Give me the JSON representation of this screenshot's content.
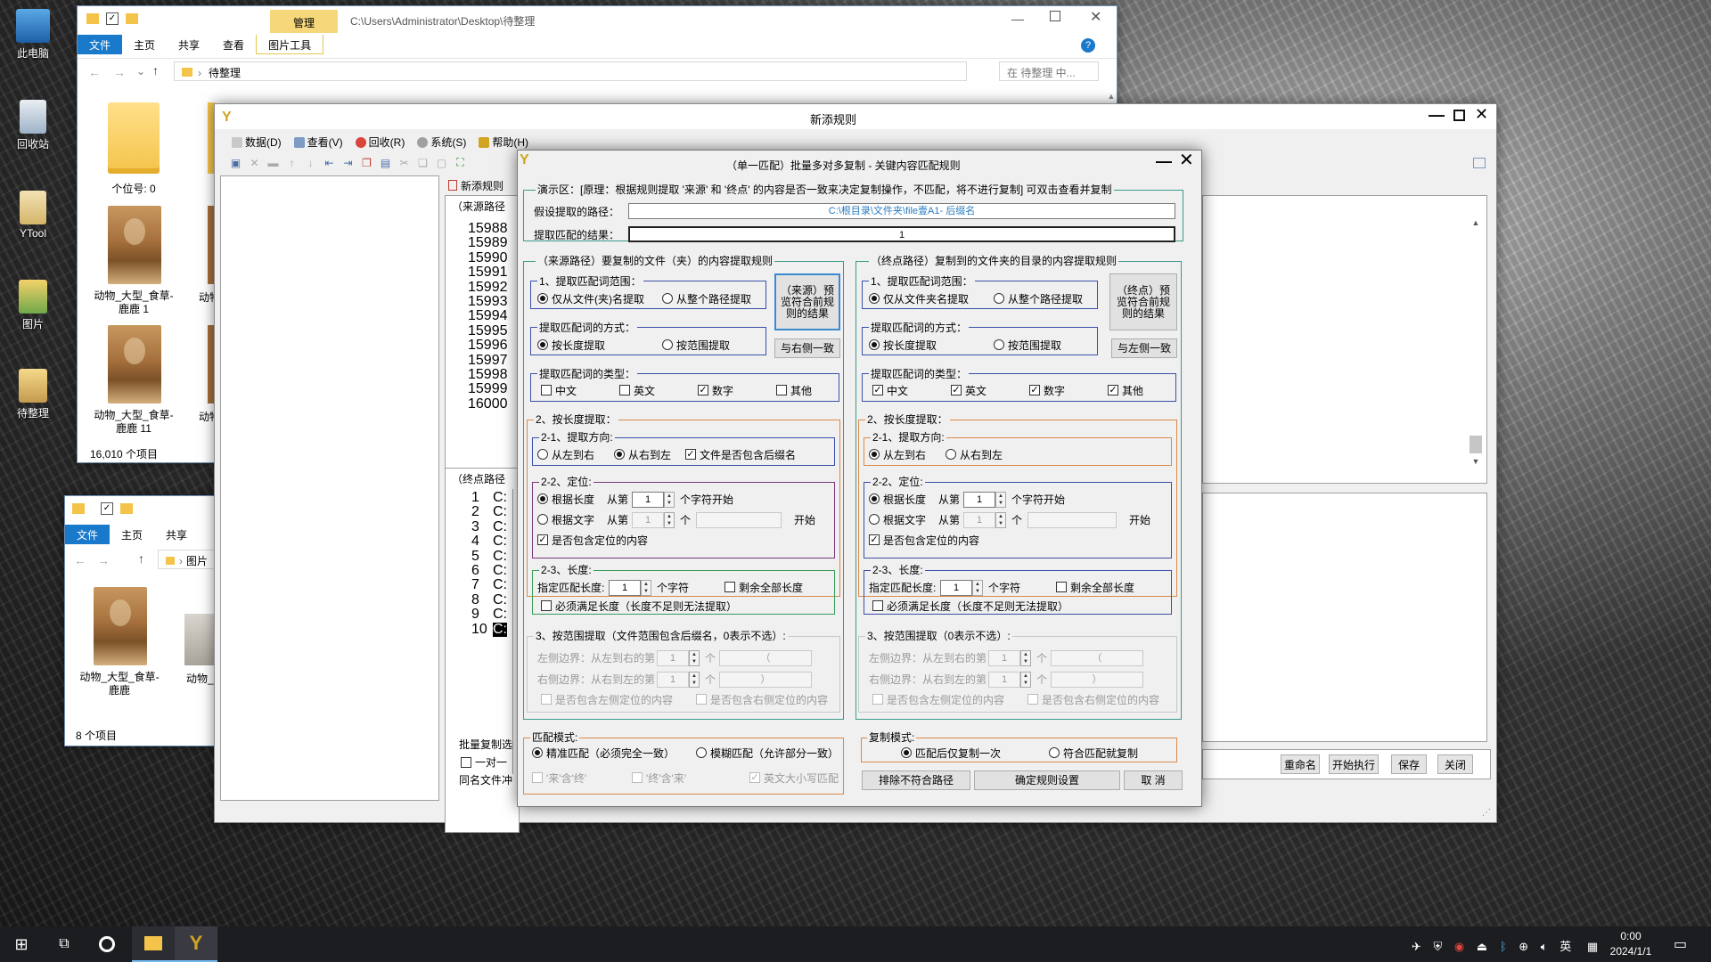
{
  "desktop": {
    "icons": [
      {
        "label": "此电脑",
        "icon": "computer-icon"
      },
      {
        "label": "回收站",
        "icon": "recycle-bin-icon"
      },
      {
        "label": "YTool",
        "icon": "ytool-icon"
      },
      {
        "label": "图片",
        "icon": "pictures-folder-icon"
      },
      {
        "label": "待整理",
        "icon": "folder-icon"
      }
    ]
  },
  "explorer_main": {
    "manage_tab": "管理",
    "path_title": "C:\\Users\\Administrator\\Desktop\\待整理",
    "tabs": [
      "文件",
      "主页",
      "共享",
      "查看",
      "图片工具"
    ],
    "address": "待整理",
    "search_placeholder": "在 待整理 中...",
    "items": [
      {
        "caption": "个位号: 0"
      },
      {
        "caption": "动物_大型_食草-鹿鹿 1"
      },
      {
        "caption": "动物_大型_食草-鹿鹿 11"
      }
    ],
    "partial_captions": [
      "动物",
      "动物"
    ],
    "status": "16,010 个项目"
  },
  "explorer_pictures": {
    "tabs": [
      "文件",
      "主页",
      "共享"
    ],
    "address": "图片",
    "items": [
      {
        "caption": "动物_大型_食草-鹿鹿"
      },
      {
        "caption": "动物_"
      }
    ],
    "status": "8 个项目"
  },
  "rule_window": {
    "title": "新添规则",
    "menu": [
      "数据(D)",
      "查看(V)",
      "回收(R)",
      "系统(S)",
      "帮助(H)"
    ],
    "left_tab": "新添规则",
    "source_section": "（来源路径",
    "source_numbers": [
      "15988",
      "15989",
      "15990",
      "15991",
      "15992",
      "15993",
      "15994",
      "15995",
      "15996",
      "15997",
      "15998",
      "15999",
      "16000"
    ],
    "dest_section": "（终点路径",
    "dest_numbers": [
      "1",
      "2",
      "3",
      "4",
      "5",
      "6",
      "7",
      "8",
      "9",
      "10"
    ],
    "dest_prefix": "C:",
    "batch_label": "批量复制选",
    "one_to_one": "一对一",
    "same_name": "同名文件冲",
    "buttons": [
      "重命名",
      "开始执行",
      "保存",
      "关闭"
    ]
  },
  "dialog": {
    "title": "（单一匹配）批量多对多复制 - 关键内容匹配规则",
    "demo_legend": "演示区：[原理：根据规则提取 '来源' 和 '终点' 的内容是否一致来决定复制操作，不匹配，将不进行复制]   可双击查看并复制",
    "assume_path_label": "假设提取的路径：",
    "assume_path_value": "C:\\根目录\\文件夹\\file壹A1- 后缀名",
    "result_label": "提取匹配的结果：",
    "result_value": "1",
    "left": {
      "legend": "（来源路径）要复制的文件（夹）的内容提取规则",
      "range_legend": "1、提取匹配词范围：",
      "range_opt1": "仅从文件(夹)名提取",
      "range_opt2": "从整个路径提取",
      "preview_btn": "（来源）预览符合前规则的结果",
      "method_legend": "提取匹配词的方式：",
      "method_opt1": "按长度提取",
      "method_opt2": "按范围提取",
      "sync_btn": "与右侧一致",
      "type_legend": "提取匹配词的类型：",
      "types": [
        {
          "label": "中文",
          "checked": false
        },
        {
          "label": "英文",
          "checked": false
        },
        {
          "label": "数字",
          "checked": true
        },
        {
          "label": "其他",
          "checked": false
        }
      ],
      "len_legend": "2、按长度提取：",
      "dir_legend": "2-1、提取方向:",
      "dir_opt1": "从左到右",
      "dir_opt2": "从右到左",
      "dir_selected": 2,
      "include_ext": "文件是否包含后缀名",
      "include_ext_checked": true,
      "pos_legend": "2-2、定位:",
      "pos_opt1": "根据长度",
      "pos_opt2": "根据文字",
      "from_label": "从第",
      "pos_value": "1",
      "pos_suffix": "个字符开始",
      "text_value": "1",
      "text_unit": "个",
      "text_start": "开始",
      "include_pos": "是否包含定位的内容",
      "length_legend": "2-3、长度:",
      "length_label": "指定匹配长度:",
      "length_value": "1",
      "length_unit": "个字符",
      "remain_all": "剩余全部长度",
      "must_len": "必须满足长度（长度不足则无法提取）",
      "range_legend2": "3、按范围提取（文件范围包含后缀名，0表示不选）:",
      "left_bound": "左侧边界：从左到右的第",
      "right_bound": "右侧边界：从右到左的第",
      "bound_value": "1",
      "bound_unit": "个",
      "left_char": "（",
      "right_char": "）",
      "inc_left": "是否包含左侧定位的内容",
      "inc_right": "是否包含右侧定位的内容"
    },
    "right": {
      "legend": "（终点路径）复制到的文件夹的目录的内容提取规则",
      "range_legend": "1、提取匹配词范围：",
      "range_opt1": "仅从文件夹名提取",
      "range_opt2": "从整个路径提取",
      "preview_btn": "（终点）预览符合前规则的结果",
      "method_legend": "提取匹配词的方式：",
      "method_opt1": "按长度提取",
      "method_opt2": "按范围提取",
      "sync_btn": "与左侧一致",
      "type_legend": "提取匹配词的类型：",
      "types": [
        {
          "label": "中文",
          "checked": true
        },
        {
          "label": "英文",
          "checked": true
        },
        {
          "label": "数字",
          "checked": true
        },
        {
          "label": "其他",
          "checked": true
        }
      ],
      "len_legend": "2、按长度提取：",
      "dir_legend": "2-1、提取方向:",
      "dir_opt1": "从左到右",
      "dir_opt2": "从右到左",
      "dir_selected": 1,
      "pos_legend": "2-2、定位:",
      "pos_opt1": "根据长度",
      "pos_opt2": "根据文字",
      "from_label": "从第",
      "pos_value": "1",
      "pos_suffix": "个字符开始",
      "text_value": "1",
      "text_unit": "个",
      "text_start": "开始",
      "include_pos": "是否包含定位的内容",
      "length_legend": "2-3、长度:",
      "length_label": "指定匹配长度:",
      "length_value": "1",
      "length_unit": "个字符",
      "remain_all": "剩余全部长度",
      "must_len": "必须满足长度（长度不足则无法提取）",
      "range_legend2": "3、按范围提取（0表示不选）:",
      "left_bound": "左侧边界：从左到右的第",
      "right_bound": "右侧边界：从右到左的第",
      "bound_value": "1",
      "bound_unit": "个",
      "left_char": "（",
      "right_char": "）",
      "inc_left": "是否包含左侧定位的内容",
      "inc_right": "是否包含右侧定位的内容"
    },
    "match_mode_legend": "匹配模式:",
    "match_exact": "精准匹配（必须完全一致）",
    "match_fuzzy": "模糊匹配（允许部分一致）",
    "src_contains_dst": "'来'含'终'",
    "dst_contains_src": "'终'含'来'",
    "case_sensitive": "英文大小写匹配",
    "copy_mode_legend": "复制模式:",
    "copy_once": "匹配后仅复制一次",
    "copy_all": "符合匹配就复制",
    "btn_exclude": "排除不符合路径",
    "btn_confirm": "确定规则设置",
    "btn_cancel": "取 消"
  },
  "taskbar": {
    "ime": "英",
    "time": "0:00",
    "date": "2024/1/1"
  },
  "colors": {
    "accent": "#1979ca",
    "teal_border": "#3a9a8a",
    "orange_border": "#d98a4a",
    "purple_border": "#7a3a7a",
    "blue_border": "#3b4fa8"
  }
}
